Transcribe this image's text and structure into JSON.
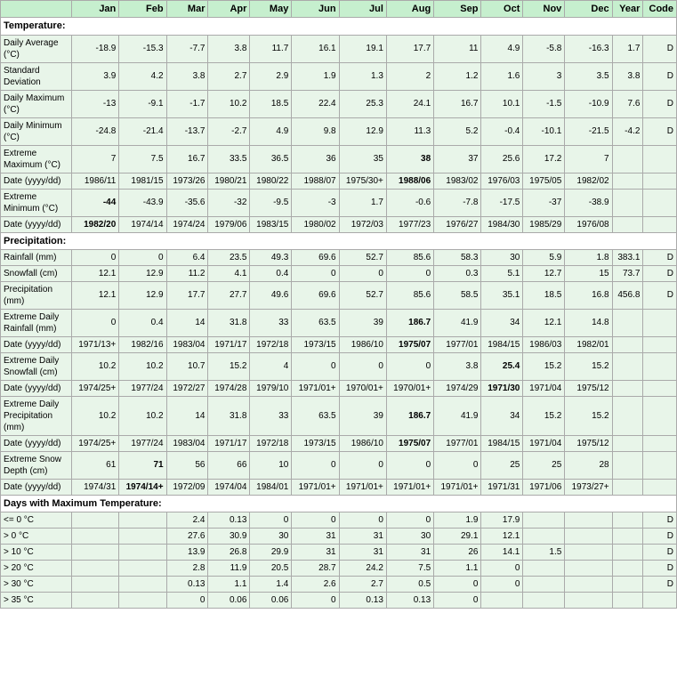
{
  "table": {
    "headers": [
      "",
      "Jan",
      "Feb",
      "Mar",
      "Apr",
      "May",
      "Jun",
      "Jul",
      "Aug",
      "Sep",
      "Oct",
      "Nov",
      "Dec",
      "Year",
      "Code"
    ],
    "sections": [
      {
        "title": "Temperature:",
        "rows": [
          {
            "label": "Daily Average (°C)",
            "values": [
              "-18.9",
              "-15.3",
              "-7.7",
              "3.8",
              "11.7",
              "16.1",
              "19.1",
              "17.7",
              "11",
              "4.9",
              "-5.8",
              "-16.3",
              "1.7",
              "D"
            ],
            "bold_cols": []
          },
          {
            "label": "Standard Deviation",
            "values": [
              "3.9",
              "4.2",
              "3.8",
              "2.7",
              "2.9",
              "1.9",
              "1.3",
              "2",
              "1.2",
              "1.6",
              "3",
              "3.5",
              "3.8",
              "D"
            ],
            "bold_cols": []
          },
          {
            "label": "Daily Maximum (°C)",
            "values": [
              "-13",
              "-9.1",
              "-1.7",
              "10.2",
              "18.5",
              "22.4",
              "25.3",
              "24.1",
              "16.7",
              "10.1",
              "-1.5",
              "-10.9",
              "7.6",
              "D"
            ],
            "bold_cols": []
          },
          {
            "label": "Daily Minimum (°C)",
            "values": [
              "-24.8",
              "-21.4",
              "-13.7",
              "-2.7",
              "4.9",
              "9.8",
              "12.9",
              "11.3",
              "5.2",
              "-0.4",
              "-10.1",
              "-21.5",
              "-4.2",
              "D"
            ],
            "bold_cols": []
          },
          {
            "label": "Extreme Maximum (°C)",
            "values": [
              "7",
              "7.5",
              "16.7",
              "33.5",
              "36.5",
              "36",
              "35",
              "38",
              "37",
              "25.6",
              "17.2",
              "7",
              "",
              ""
            ],
            "bold_cols": [
              7
            ]
          },
          {
            "label": "Date (yyyy/dd)",
            "values": [
              "1986/11",
              "1981/15",
              "1973/26",
              "1980/21",
              "1980/22",
              "1988/07",
              "1975/30+",
              "1988/06",
              "1983/02",
              "1976/03",
              "1975/05",
              "1982/02",
              "",
              ""
            ],
            "bold_cols": [
              7
            ]
          },
          {
            "label": "Extreme Minimum (°C)",
            "values": [
              "-44",
              "-43.9",
              "-35.6",
              "-32",
              "-9.5",
              "-3",
              "1.7",
              "-0.6",
              "-7.8",
              "-17.5",
              "-37",
              "-38.9",
              "",
              ""
            ],
            "bold_cols": [
              0
            ]
          },
          {
            "label": "Date (yyyy/dd)",
            "values": [
              "1982/20",
              "1974/14",
              "1974/24",
              "1979/06",
              "1983/15",
              "1980/02",
              "1972/03",
              "1977/23",
              "1976/27",
              "1984/30",
              "1985/29",
              "1976/08",
              "",
              ""
            ],
            "bold_cols": [
              0
            ]
          }
        ]
      },
      {
        "title": "Precipitation:",
        "rows": [
          {
            "label": "Rainfall (mm)",
            "values": [
              "0",
              "0",
              "6.4",
              "23.5",
              "49.3",
              "69.6",
              "52.7",
              "85.6",
              "58.3",
              "30",
              "5.9",
              "1.8",
              "383.1",
              "D"
            ],
            "bold_cols": []
          },
          {
            "label": "Snowfall (cm)",
            "values": [
              "12.1",
              "12.9",
              "11.2",
              "4.1",
              "0.4",
              "0",
              "0",
              "0",
              "0.3",
              "5.1",
              "12.7",
              "15",
              "73.7",
              "D"
            ],
            "bold_cols": []
          },
          {
            "label": "Precipitation (mm)",
            "values": [
              "12.1",
              "12.9",
              "17.7",
              "27.7",
              "49.6",
              "69.6",
              "52.7",
              "85.6",
              "58.5",
              "35.1",
              "18.5",
              "16.8",
              "456.8",
              "D"
            ],
            "bold_cols": []
          },
          {
            "label": "Extreme Daily Rainfall (mm)",
            "values": [
              "0",
              "0.4",
              "14",
              "31.8",
              "33",
              "63.5",
              "39",
              "186.7",
              "41.9",
              "34",
              "12.1",
              "14.8",
              "",
              ""
            ],
            "bold_cols": [
              7
            ]
          },
          {
            "label": "Date (yyyy/dd)",
            "values": [
              "1971/13+",
              "1982/16",
              "1983/04",
              "1971/17",
              "1972/18",
              "1973/15",
              "1986/10",
              "1975/07",
              "1977/01",
              "1984/15",
              "1986/03",
              "1982/01",
              "",
              ""
            ],
            "bold_cols": [
              7
            ]
          },
          {
            "label": "Extreme Daily Snowfall (cm)",
            "values": [
              "10.2",
              "10.2",
              "10.7",
              "15.2",
              "4",
              "0",
              "0",
              "0",
              "3.8",
              "25.4",
              "15.2",
              "15.2",
              "",
              ""
            ],
            "bold_cols": [
              9
            ]
          },
          {
            "label": "Date (yyyy/dd)",
            "values": [
              "1974/25+",
              "1977/24",
              "1972/27",
              "1974/28",
              "1979/10",
              "1971/01+",
              "1970/01+",
              "1970/01+",
              "1974/29",
              "1971/30",
              "1971/04",
              "1975/12",
              "",
              ""
            ],
            "bold_cols": [
              9
            ]
          },
          {
            "label": "Extreme Daily Precipitation (mm)",
            "values": [
              "10.2",
              "10.2",
              "14",
              "31.8",
              "33",
              "63.5",
              "39",
              "186.7",
              "41.9",
              "34",
              "15.2",
              "15.2",
              "",
              ""
            ],
            "bold_cols": [
              7
            ]
          },
          {
            "label": "Date (yyyy/dd)",
            "values": [
              "1974/25+",
              "1977/24",
              "1983/04",
              "1971/17",
              "1972/18",
              "1973/15",
              "1986/10",
              "1975/07",
              "1977/01",
              "1984/15",
              "1971/04",
              "1975/12",
              "",
              ""
            ],
            "bold_cols": [
              7
            ]
          },
          {
            "label": "Extreme Snow Depth (cm)",
            "values": [
              "61",
              "71",
              "56",
              "66",
              "10",
              "0",
              "0",
              "0",
              "0",
              "25",
              "25",
              "28",
              "",
              ""
            ],
            "bold_cols": [
              1
            ]
          },
          {
            "label": "Date (yyyy/dd)",
            "values": [
              "1974/31",
              "1974/14+",
              "1972/09",
              "1974/04",
              "1984/01",
              "1971/01+",
              "1971/01+",
              "1971/01+",
              "1971/01+",
              "1971/31",
              "1971/06",
              "1973/27+",
              "",
              ""
            ],
            "bold_cols": [
              1
            ]
          }
        ]
      },
      {
        "title": "Days with Maximum Temperature:",
        "rows": [
          {
            "label": "<= 0 °C",
            "values": [
              "",
              "",
              "2.4",
              "0.13",
              "0",
              "0",
              "0",
              "0",
              "1.9",
              "17.9",
              "",
              "",
              "",
              "D"
            ],
            "bold_cols": []
          },
          {
            "label": "> 0 °C",
            "values": [
              "",
              "",
              "27.6",
              "30.9",
              "30",
              "31",
              "31",
              "30",
              "29.1",
              "12.1",
              "",
              "",
              "",
              "D"
            ],
            "bold_cols": []
          },
          {
            "label": "> 10 °C",
            "values": [
              "",
              "",
              "13.9",
              "26.8",
              "29.9",
              "31",
              "31",
              "31",
              "26",
              "14.1",
              "1.5",
              "",
              "",
              "D"
            ],
            "bold_cols": []
          },
          {
            "label": "> 20 °C",
            "values": [
              "",
              "",
              "2.8",
              "11.9",
              "20.5",
              "28.7",
              "24.2",
              "7.5",
              "1.1",
              "0",
              "",
              "",
              "",
              "D"
            ],
            "bold_cols": []
          },
          {
            "label": "> 30 °C",
            "values": [
              "",
              "",
              "0.13",
              "1.1",
              "1.4",
              "2.6",
              "2.7",
              "0.5",
              "0",
              "0",
              "",
              "",
              "",
              "D"
            ],
            "bold_cols": []
          },
          {
            "label": "> 35 °C",
            "values": [
              "",
              "",
              "0",
              "0.06",
              "0.06",
              "0",
              "0.13",
              "0.13",
              "0",
              "",
              "",
              "",
              "",
              ""
            ],
            "bold_cols": []
          }
        ]
      }
    ]
  }
}
